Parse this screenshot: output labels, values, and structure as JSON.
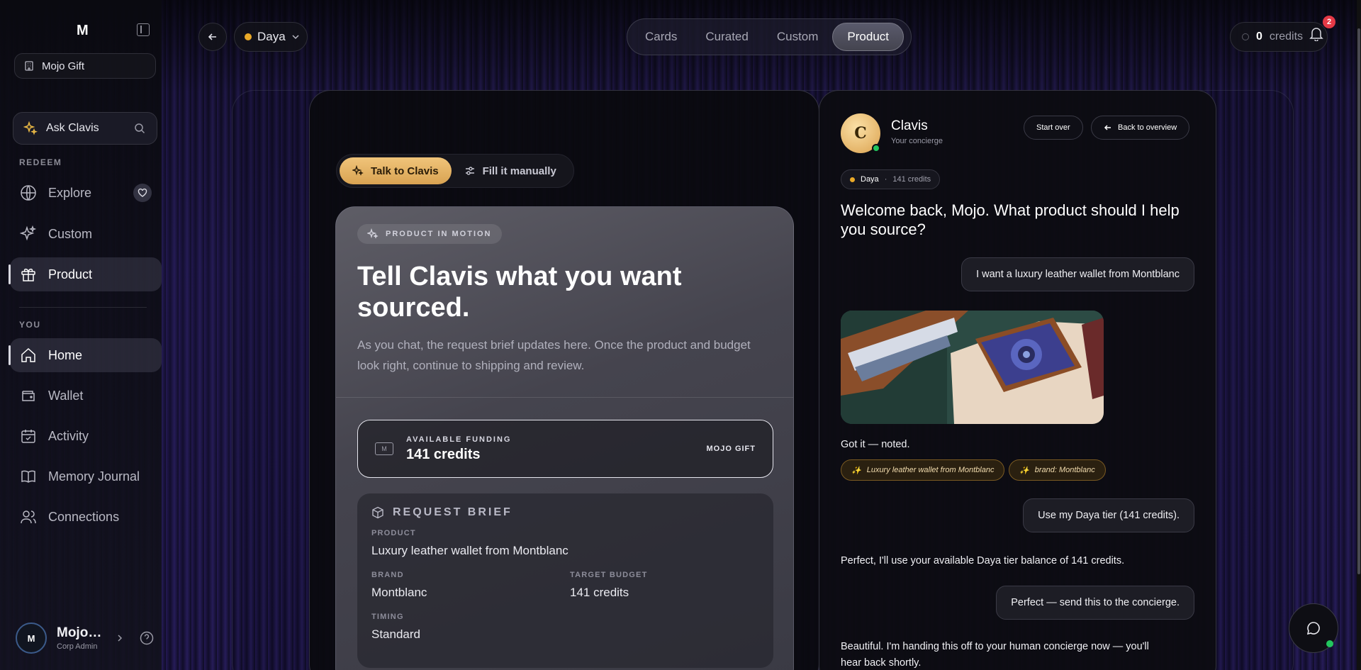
{
  "sidebar": {
    "logo": "M",
    "org": "Mojo Gift",
    "ask": "Ask Clavis",
    "sections": {
      "redeem": "REDEEM",
      "you": "YOU"
    },
    "redeem_items": [
      {
        "label": "Explore",
        "icon": "globe-icon"
      },
      {
        "label": "Custom",
        "icon": "sparkles-icon"
      },
      {
        "label": "Product",
        "icon": "gift-icon",
        "active": true
      }
    ],
    "you_items": [
      {
        "label": "Home",
        "icon": "home-icon",
        "active": true
      },
      {
        "label": "Wallet",
        "icon": "wallet-icon"
      },
      {
        "label": "Activity",
        "icon": "calendar-icon"
      },
      {
        "label": "Memory Journal",
        "icon": "book-icon"
      },
      {
        "label": "Connections",
        "icon": "users-icon"
      }
    ],
    "user": {
      "initial": "M",
      "name": "Mojo…",
      "role": "Corp Admin"
    }
  },
  "topbar": {
    "tier": "Daya",
    "tabs": [
      "Cards",
      "Curated",
      "Custom",
      "Product"
    ],
    "active_tab": "Product",
    "credits_value": "0",
    "credits_label": "credits",
    "notifications": "2"
  },
  "toggle": {
    "talk": "Talk to Clavis",
    "manual": "Fill it manually"
  },
  "card": {
    "chip": "PRODUCT IN MOTION",
    "title": "Tell Clavis what you want sourced.",
    "subtitle": "As you chat, the request brief updates here. Once the product and budget look right, continue to shipping and review.",
    "funding": {
      "label": "AVAILABLE FUNDING",
      "value": "141 credits",
      "source": "MOJO GIFT"
    },
    "brief": {
      "title": "REQUEST BRIEF",
      "product_label": "PRODUCT",
      "product": "Luxury leather wallet from Montblanc",
      "brand_label": "BRAND",
      "brand": "Montblanc",
      "budget_label": "TARGET BUDGET",
      "budget": "141 credits",
      "timing_label": "TIMING",
      "timing": "Standard"
    }
  },
  "chat": {
    "initial": "C",
    "name": "Clavis",
    "role": "Your concierge",
    "start_over": "Start over",
    "back": "Back to overview",
    "tier": "Daya",
    "tier_credits": "141 credits",
    "welcome": "Welcome back, Mojo. What product should I help you source?",
    "msg1": "I want a luxury leather wallet from Montblanc",
    "reply1": "Got it — noted.",
    "tags": [
      "Luxury leather wallet from Montblanc",
      "brand: Montblanc"
    ],
    "msg2": "Use my Daya tier (141 credits).",
    "reply2": "Perfect, I'll use your available Daya tier balance of 141 credits.",
    "msg3": "Perfect — send this to the concierge.",
    "reply3": "Beautiful. I'm handing this off to your human concierge now — you'll hear back shortly."
  },
  "colors": {
    "accent_gold": "#e9a928",
    "online_green": "#22c55e",
    "badge_red": "#e53946"
  }
}
